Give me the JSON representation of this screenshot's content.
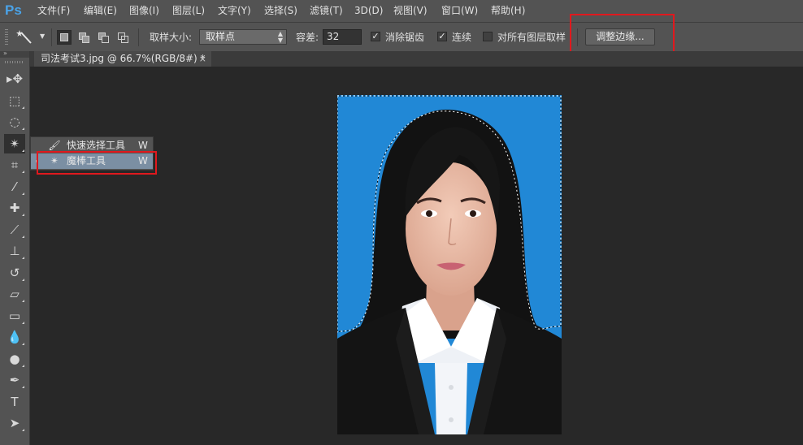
{
  "app": {
    "logo": "Ps"
  },
  "menu": {
    "items": [
      "文件(F)",
      "编辑(E)",
      "图像(I)",
      "图层(L)",
      "文字(Y)",
      "选择(S)",
      "滤镜(T)",
      "3D(D)",
      "视图(V)",
      "窗口(W)",
      "帮助(H)"
    ]
  },
  "options": {
    "tool_icon": "magic-wand-icon",
    "sample_size_label": "取样大小:",
    "sample_size_value": "取样点",
    "tolerance_label": "容差:",
    "tolerance_value": "32",
    "anti_alias_label": "消除锯齿",
    "anti_alias_checked": true,
    "contiguous_label": "连续",
    "contiguous_checked": true,
    "sample_all_layers_label": "对所有图层取样",
    "sample_all_layers_checked": false,
    "refine_edge_label": "调整边缘..."
  },
  "document": {
    "tab_title": "司法考试3.jpg @ 66.7%(RGB/8#) *",
    "close_glyph": "×"
  },
  "flyout": {
    "items": [
      {
        "icon": "quick-selection-icon",
        "label": "快速选择工具",
        "shortcut": "W",
        "selected": false
      },
      {
        "icon": "magic-wand-icon",
        "label": "魔棒工具",
        "shortcut": "W",
        "selected": true
      }
    ]
  },
  "tools": [
    {
      "name": "move-tool",
      "glyph": "▸✥"
    },
    {
      "name": "marquee-tool",
      "glyph": "⬚"
    },
    {
      "name": "lasso-tool",
      "glyph": "◌"
    },
    {
      "name": "magic-wand-tool",
      "glyph": "✴"
    },
    {
      "name": "crop-tool",
      "glyph": "⌗"
    },
    {
      "name": "eyedropper-tool",
      "glyph": "⁄"
    },
    {
      "name": "healing-brush-tool",
      "glyph": "✚"
    },
    {
      "name": "brush-tool",
      "glyph": "⟋"
    },
    {
      "name": "clone-stamp-tool",
      "glyph": "⊥"
    },
    {
      "name": "history-brush-tool",
      "glyph": "↺"
    },
    {
      "name": "eraser-tool",
      "glyph": "▱"
    },
    {
      "name": "gradient-tool",
      "glyph": "▭"
    },
    {
      "name": "blur-tool",
      "glyph": "💧"
    },
    {
      "name": "dodge-tool",
      "glyph": "●"
    },
    {
      "name": "pen-tool",
      "glyph": "✒"
    },
    {
      "name": "type-tool",
      "glyph": "T"
    },
    {
      "name": "path-selection-tool",
      "glyph": "➤"
    }
  ],
  "colors": {
    "photo_background": "#2188d6",
    "highlight_box": "#e0191e",
    "flyout_selected": "#7b8fa3"
  }
}
